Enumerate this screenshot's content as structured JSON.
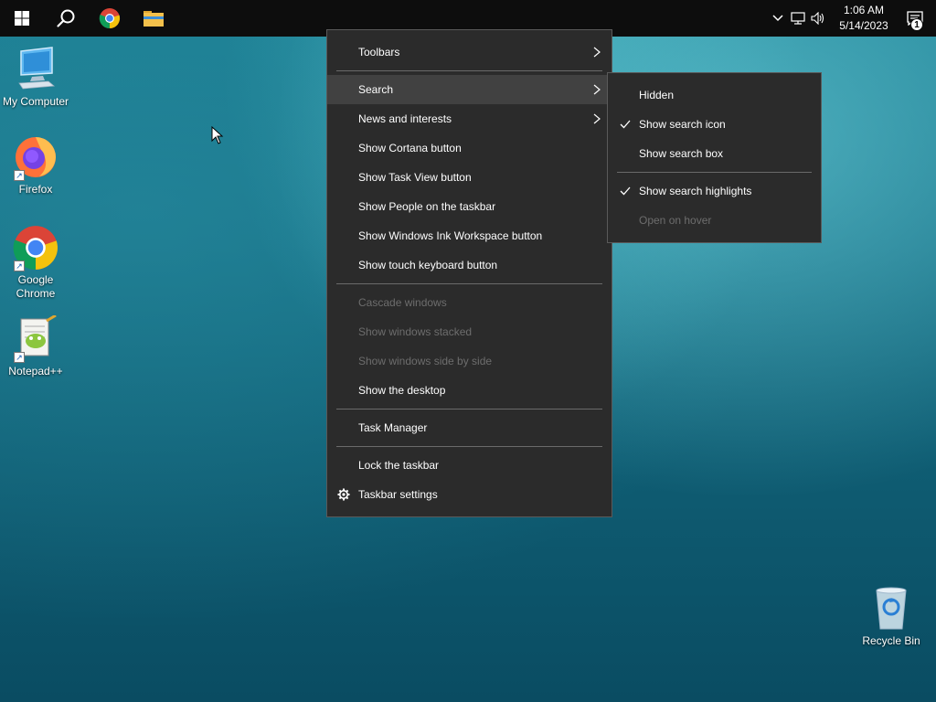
{
  "taskbar": {
    "clock_time": "1:06 AM",
    "clock_date": "5/14/2023",
    "notification_count": "1"
  },
  "desktop": {
    "icons": [
      {
        "label": "My Computer"
      },
      {
        "label": "Firefox"
      },
      {
        "label": "Google Chrome"
      },
      {
        "label": "Notepad++"
      },
      {
        "label": "Recycle Bin"
      }
    ]
  },
  "context_menu": {
    "items": [
      {
        "label": "Toolbars"
      },
      {
        "label": "Search"
      },
      {
        "label": "News and interests"
      },
      {
        "label": "Show Cortana button"
      },
      {
        "label": "Show Task View button"
      },
      {
        "label": "Show People on the taskbar"
      },
      {
        "label": "Show Windows Ink Workspace button"
      },
      {
        "label": "Show touch keyboard button"
      },
      {
        "label": "Cascade windows"
      },
      {
        "label": "Show windows stacked"
      },
      {
        "label": "Show windows side by side"
      },
      {
        "label": "Show the desktop"
      },
      {
        "label": "Task Manager"
      },
      {
        "label": "Lock the taskbar"
      },
      {
        "label": "Taskbar settings"
      }
    ]
  },
  "search_submenu": {
    "items": [
      {
        "label": "Hidden",
        "checked": false
      },
      {
        "label": "Show search icon",
        "checked": true
      },
      {
        "label": "Show search box",
        "checked": false
      },
      {
        "label": "Show search highlights",
        "checked": true
      },
      {
        "label": "Open on hover",
        "checked": false
      }
    ]
  },
  "colors": {
    "taskbar_bg": "#0d0d0d",
    "menu_bg": "#2b2b2b",
    "menu_hover": "#414141",
    "disabled_text": "#6d6d6d"
  }
}
